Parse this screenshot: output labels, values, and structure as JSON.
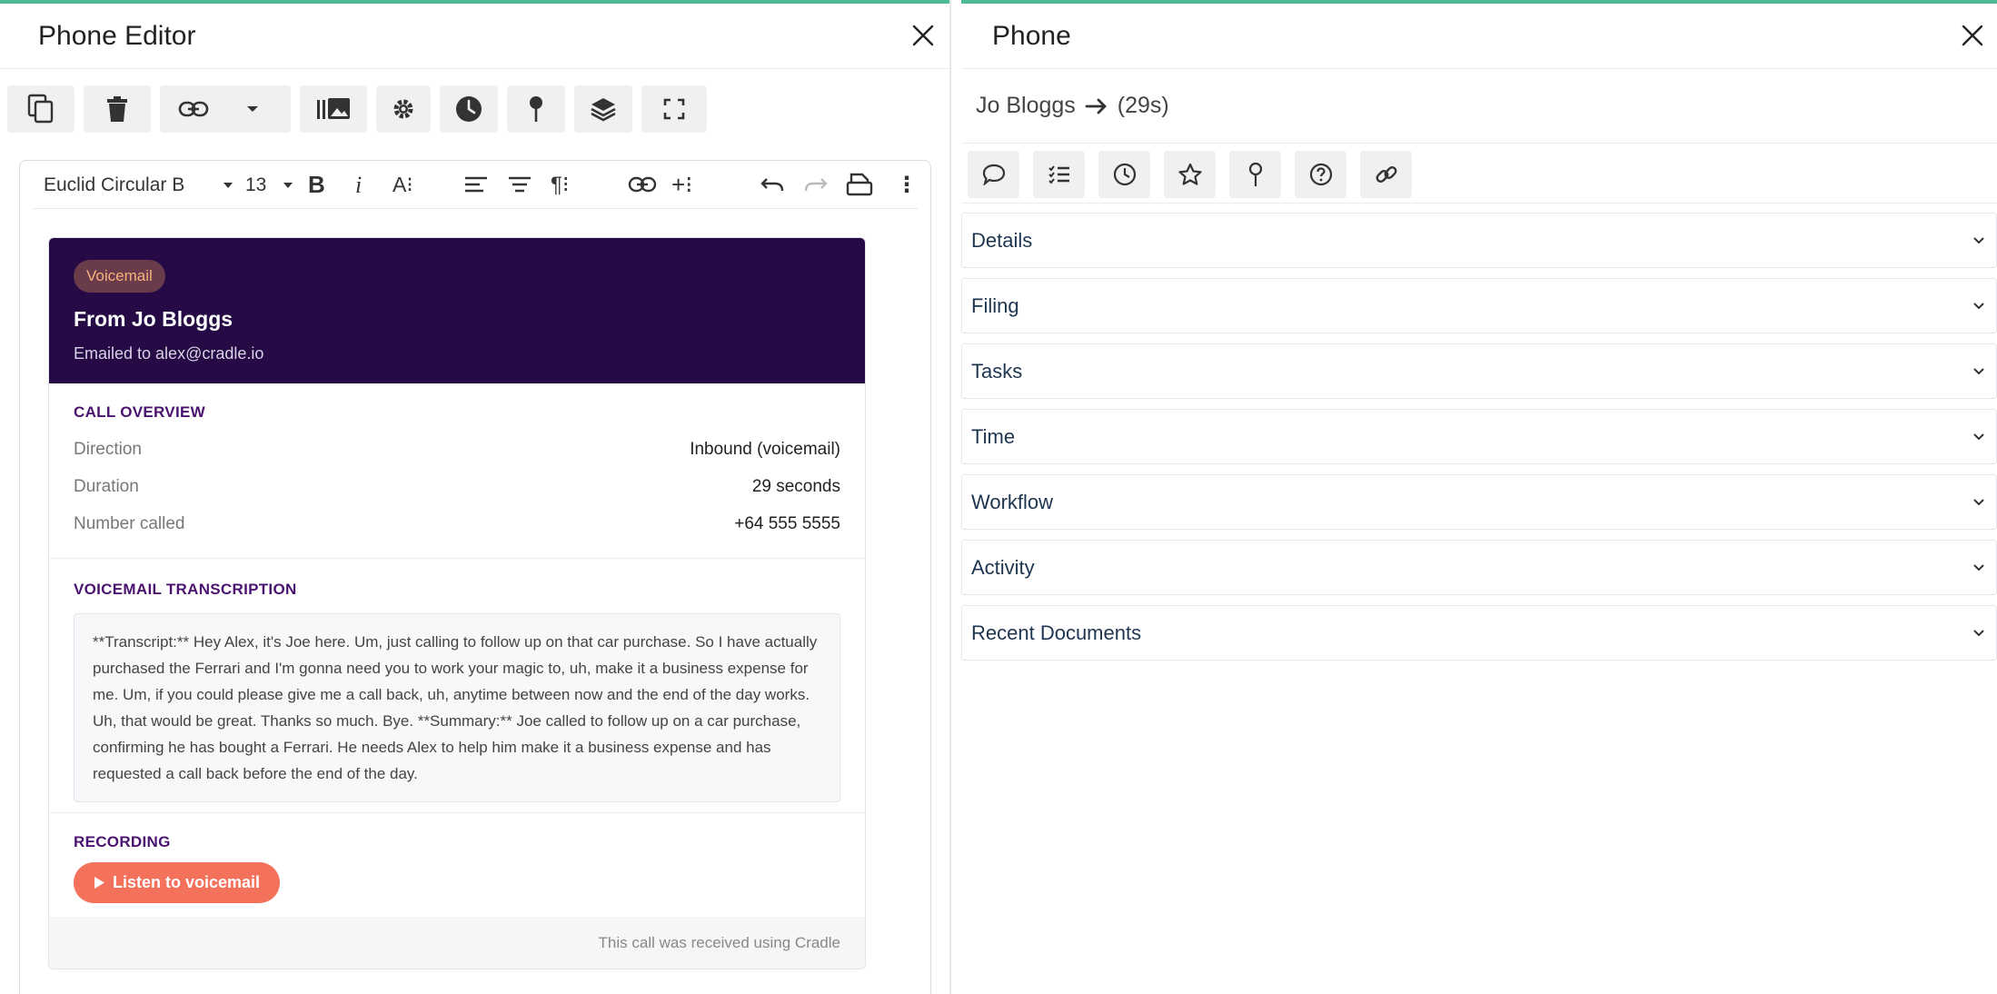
{
  "left_panel": {
    "title": "Phone Editor",
    "toolbar": [
      "copy",
      "delete",
      "link",
      "dropdown",
      "library",
      "settings",
      "history",
      "pin",
      "layers",
      "fullscreen"
    ]
  },
  "editor_toolbar": {
    "font": "Euclid Circular B",
    "size": "13"
  },
  "email": {
    "badge": "Voicemail",
    "title": "From Jo Bloggs",
    "subtitle": "Emailed to alex@cradle.io",
    "overview_label": "CALL OVERVIEW",
    "rows": [
      {
        "key": "Direction",
        "value": "Inbound (voicemail)"
      },
      {
        "key": "Duration",
        "value": "29 seconds"
      },
      {
        "key": "Number called",
        "value": "+64 555 5555"
      }
    ],
    "transcription_label": "VOICEMAIL TRANSCRIPTION",
    "transcript": "**Transcript:** Hey Alex, it's Joe here. Um, just calling to follow up on that car purchase. So I have actually purchased the Ferrari and I'm gonna need you to work your magic to, uh, make it a business expense for me. Um, if you could please give me a call back, uh, anytime between now and the end of the day works. Uh, that would be great. Thanks so much. Bye. **Summary:** Joe called to follow up on a car purchase, confirming he has bought a Ferrari. He needs Alex to help him make it a business expense and has requested a call back before the end of the day.",
    "recording_label": "RECORDING",
    "listen_label": "Listen to voicemail",
    "footer": "This call was received using Cradle"
  },
  "right_panel": {
    "title": "Phone",
    "caller": "Jo Bloggs",
    "duration": "(29s)",
    "icons": [
      "comment-icon",
      "tasks-icon",
      "clock-icon",
      "star-icon",
      "pin-icon",
      "help-icon",
      "link-icon"
    ],
    "sections": [
      "Details",
      "Filing",
      "Tasks",
      "Time",
      "Workflow",
      "Activity",
      "Recent Documents"
    ]
  },
  "colors": {
    "accent_top": "#4dbb94",
    "header_bg": "#250a45",
    "section_label": "#4b1370",
    "listen_btn": "#f4715c"
  }
}
